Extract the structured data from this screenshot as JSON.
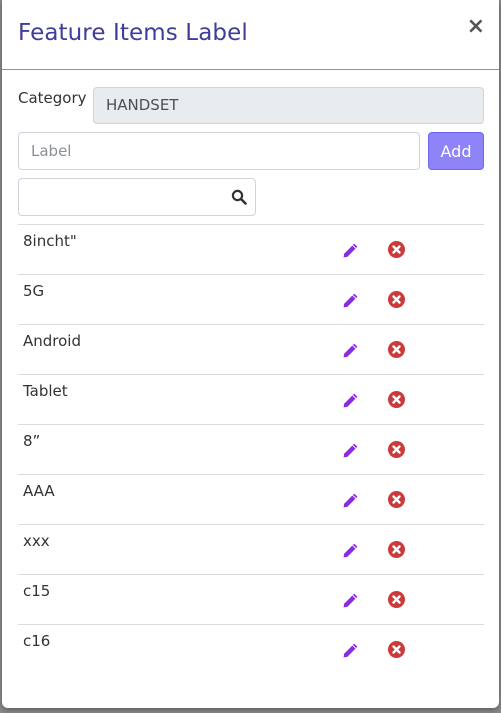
{
  "modal": {
    "title": "Feature Items Label",
    "close_label": "×"
  },
  "form": {
    "category_label": "Category",
    "category_value": "HANDSET",
    "label_placeholder": "Label",
    "label_value": "",
    "add_button": "Add",
    "search_value": "",
    "search_placeholder": ""
  },
  "items": [
    {
      "label": "8incht\""
    },
    {
      "label": "5G"
    },
    {
      "label": "Android"
    },
    {
      "label": "Tablet"
    },
    {
      "label": "8”"
    },
    {
      "label": "AAA"
    },
    {
      "label": "xxx"
    },
    {
      "label": "c15"
    },
    {
      "label": "c16"
    }
  ],
  "colors": {
    "title": "#3f3d99",
    "accent": "#8e84f7",
    "edit_icon": "#8a2be2",
    "delete_icon": "#cc3b3b"
  }
}
